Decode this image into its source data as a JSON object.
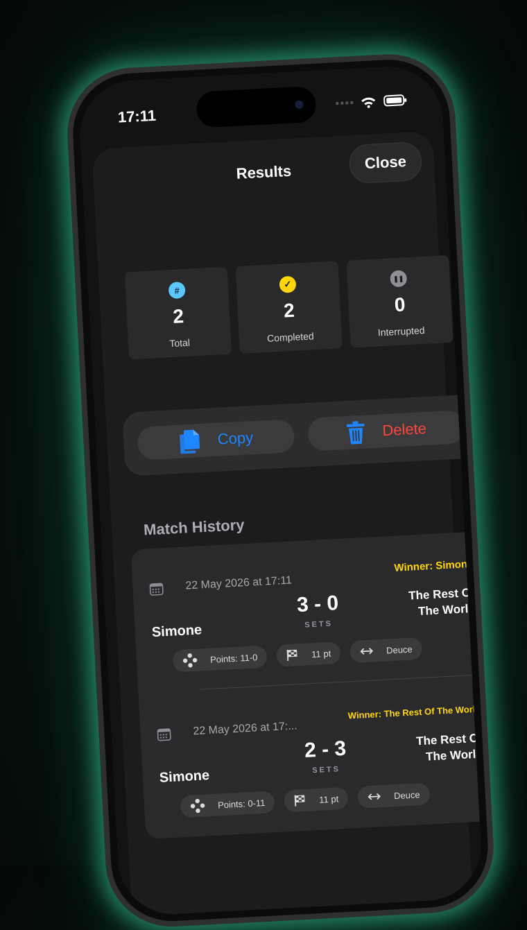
{
  "status_bar": {
    "time": "17:11"
  },
  "header": {
    "title": "Results",
    "close_label": "Close"
  },
  "stats": [
    {
      "icon": "hash-icon",
      "icon_glyph": "#",
      "value": "2",
      "label": "Total",
      "color": "#5ac8fa"
    },
    {
      "icon": "checkmark-icon",
      "icon_glyph": "✓",
      "value": "2",
      "label": "Completed",
      "color": "#ffd60a"
    },
    {
      "icon": "pause-icon",
      "icon_glyph": "❚❚",
      "value": "0",
      "label": "Interrupted",
      "color": "#8e8e93"
    }
  ],
  "actions": {
    "copy_label": "Copy",
    "delete_label": "Delete"
  },
  "history": {
    "title": "Match History",
    "matches": [
      {
        "date": "22 May 2026 at 17:11",
        "winner": "Winner: Simone",
        "player1": "Simone",
        "score": "3 - 0",
        "score_unit": "SETS",
        "player2": "The Rest Of The World",
        "points": "Points: 11-0",
        "target": "11 pt",
        "mode": "Deuce"
      },
      {
        "date": "22 May 2026 at 17:...",
        "winner": "Winner: The Rest Of The World",
        "player1": "Simone",
        "score": "2 - 3",
        "score_unit": "SETS",
        "player2": "The Rest Of The World",
        "points": "Points: 0-11",
        "target": "11 pt",
        "mode": "Deuce"
      }
    ]
  },
  "colors": {
    "accent_blue": "#1e86ff",
    "danger_red": "#ff453a",
    "winner_yellow": "#ffd60a",
    "glow_green": "#36c896"
  }
}
